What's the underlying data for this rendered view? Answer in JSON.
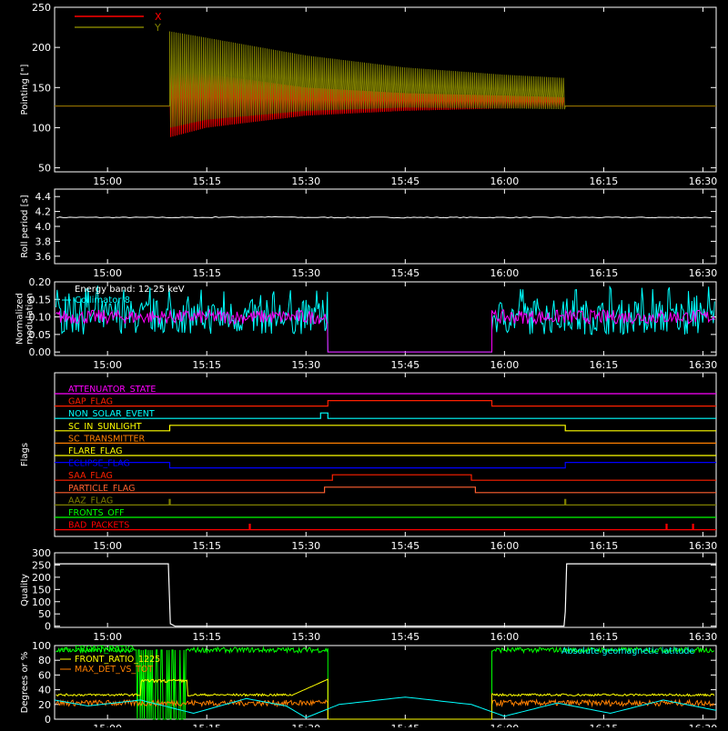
{
  "chart_data": {
    "time_ticks": [
      "15:00",
      "15:15",
      "15:30",
      "15:45",
      "16:00",
      "16:15",
      "16:30"
    ],
    "time_tick_minutes": [
      900,
      915,
      930,
      945,
      960,
      975,
      990
    ],
    "xlim_minutes": [
      892,
      992
    ],
    "panels": [
      {
        "id": "pointing",
        "type": "line",
        "ylabel": "Pointing [\"]",
        "ylim": [
          45,
          250
        ],
        "yticks": [
          50,
          100,
          150,
          200,
          250
        ],
        "legend": {
          "placement": "top-left",
          "entries": [
            {
              "name": "X",
              "color": "#ff0000"
            },
            {
              "name": "Y",
              "color": "#808000"
            }
          ]
        },
        "series": [
          {
            "name": "X",
            "color": "#ff0000",
            "baseline": 127,
            "oscillation_start": 909.4,
            "oscillation_end": 969.2,
            "min_envelope": [
              [
                909.4,
                88
              ],
              [
                915,
                100
              ],
              [
                930,
                115
              ],
              [
                945,
                121
              ],
              [
                960,
                124
              ],
              [
                969,
                125
              ]
            ],
            "max_envelope": [
              [
                909.4,
                175
              ],
              [
                915,
                167
              ],
              [
                930,
                150
              ],
              [
                945,
                143
              ],
              [
                960,
                140
              ],
              [
                969,
                138
              ]
            ]
          },
          {
            "name": "Y",
            "color": "#808000",
            "baseline": 127,
            "oscillation_start": 909.4,
            "oscillation_end": 969.2,
            "min_envelope": [
              [
                909.4,
                100
              ],
              [
                915,
                110
              ],
              [
                930,
                121
              ],
              [
                945,
                125
              ],
              [
                960,
                124
              ],
              [
                969,
                123
              ]
            ],
            "max_envelope": [
              [
                909.4,
                220
              ],
              [
                915,
                212
              ],
              [
                930,
                190
              ],
              [
                945,
                175
              ],
              [
                960,
                166
              ],
              [
                969,
                162
              ]
            ]
          }
        ]
      },
      {
        "id": "roll",
        "type": "line",
        "ylabel": "Roll period [s]",
        "ylim": [
          3.5,
          4.5
        ],
        "yticks": [
          3.6,
          3.8,
          4.0,
          4.2,
          4.4
        ],
        "ytick_labels": [
          "3.6",
          "3.8",
          "4.0",
          "4.2",
          "4.4"
        ],
        "series": [
          {
            "name": "Roll period",
            "color": "#ffffff",
            "value": 4.12
          }
        ]
      },
      {
        "id": "modulation",
        "type": "line",
        "ylabel": "Normalized modulation",
        "ylim": [
          -0.01,
          0.2
        ],
        "yticks": [
          0.0,
          0.05,
          0.1,
          0.15,
          0.2
        ],
        "ytick_labels": [
          "0.00",
          "0.05",
          "0.10",
          "0.15",
          "0.20"
        ],
        "annotations": [
          "Energy band: 12-25 keV",
          "Collimator 8"
        ],
        "gaps": [
          [
            933.3,
            958.1
          ]
        ],
        "series": [
          {
            "name": "Collimator 8",
            "color": "#00ffff",
            "mean": 0.1,
            "spread": 0.05
          },
          {
            "name": "Energy band: 12-25 keV",
            "color": "#ff00ff",
            "mean": 0.1,
            "spread": 0.02
          }
        ]
      },
      {
        "id": "flags",
        "type": "line",
        "ylabel": "Flags",
        "flags": [
          {
            "name": "ATTENUATOR_STATE",
            "color": "#ff00ff",
            "on": []
          },
          {
            "name": "GAP_FLAG",
            "color": "#ff2000",
            "on": [
              [
                933.3,
                958.1
              ]
            ]
          },
          {
            "name": "NON_SOLAR_EVENT",
            "color": "#00ffff",
            "on": [
              [
                932.2,
                933.3
              ]
            ]
          },
          {
            "name": "SC_IN_SUNLIGHT",
            "color": "#ffff00",
            "on": [
              [
                909.4,
                969.2
              ]
            ]
          },
          {
            "name": "SC_TRANSMITTER",
            "color": "#ff8000",
            "on": []
          },
          {
            "name": "FLARE_FLAG",
            "color": "#ffff00",
            "on": []
          },
          {
            "name": "ECLIPSE_FLAG",
            "color": "#0000ff",
            "on_before": 909.4,
            "on_after": 969.2
          },
          {
            "name": "SAA_FLAG",
            "color": "#ff2000",
            "on": [
              [
                934,
                955
              ]
            ]
          },
          {
            "name": "PARTICLE_FLAG",
            "color": "#ff6030",
            "on": [
              [
                932.8,
                955.6
              ]
            ]
          },
          {
            "name": "AAZ_FLAG",
            "color": "#808000",
            "spikes": [
              909.4,
              969.2
            ]
          },
          {
            "name": "FRONTS_OFF",
            "color": "#00ff00",
            "on": []
          },
          {
            "name": "BAD_PACKETS",
            "color": "#ff0000",
            "spikes": [
              921.5,
              984.5,
              988.5
            ]
          }
        ]
      },
      {
        "id": "quality",
        "type": "line",
        "ylabel": "Quality",
        "ylim": [
          -5,
          300
        ],
        "yticks": [
          0,
          50,
          100,
          150,
          200,
          250,
          300
        ],
        "series": [
          {
            "name": "Quality",
            "color": "#ffffff",
            "points": [
              [
                892,
                255
              ],
              [
                909.2,
                255
              ],
              [
                909.5,
                10
              ],
              [
                910.2,
                0
              ],
              [
                969.0,
                0
              ],
              [
                969.2,
                60
              ],
              [
                969.4,
                255
              ],
              [
                992,
                255
              ]
            ]
          }
        ]
      },
      {
        "id": "ratios",
        "type": "line",
        "ylabel": "Degrees or %",
        "ylim": [
          0,
          100
        ],
        "yticks": [
          0,
          20,
          40,
          60,
          80,
          100
        ],
        "legend": {
          "placement": "top-left"
        },
        "annotations": [
          "Absolute geomagnetic latitude"
        ],
        "gaps": [
          [
            933.3,
            958.1
          ]
        ],
        "series": [
          {
            "name": "FRONT_RATIO",
            "color": "#00ff00",
            "level": 94
          },
          {
            "name": "FRONT_RATIO_1225",
            "color": "#ffff00",
            "level": 33
          },
          {
            "name": "MAX_DET_VS_TOT",
            "color": "#ff8000",
            "level": 22
          },
          {
            "name": "Absolute geomagnetic latitude",
            "color": "#00ffff",
            "points": [
              [
                892,
                26
              ],
              [
                897,
                18
              ],
              [
                905,
                26
              ],
              [
                913,
                8
              ],
              [
                921,
                28
              ],
              [
                927,
                18
              ],
              [
                930,
                2
              ],
              [
                935,
                20
              ],
              [
                945,
                30
              ],
              [
                955,
                20
              ],
              [
                960,
                4
              ],
              [
                968,
                22
              ],
              [
                976,
                8
              ],
              [
                984,
                26
              ],
              [
                992,
                12
              ]
            ]
          }
        ]
      }
    ]
  }
}
